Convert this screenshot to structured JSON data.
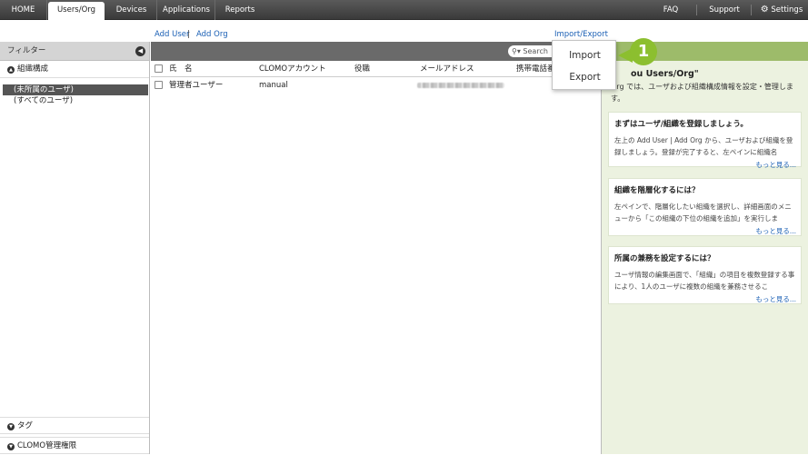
{
  "topnav": {
    "tabs": [
      {
        "label": "HOME"
      },
      {
        "label": "Users/Org"
      },
      {
        "label": "Devices"
      },
      {
        "label": "Applications"
      },
      {
        "label": "Reports"
      }
    ],
    "right": [
      {
        "label": "FAQ"
      },
      {
        "label": "Support"
      },
      {
        "label": "Settings"
      }
    ]
  },
  "actions": {
    "add_user": "Add User",
    "separator": "|",
    "add_org": "Add Org",
    "import_export": "Import/Export"
  },
  "sidebar": {
    "filter_header": "フィルター",
    "sections": {
      "org": "組織構成",
      "tag": "タグ",
      "admin": "CLOMO管理権限"
    },
    "tree": [
      {
        "label": "(未所属のユーザ)",
        "selected": true
      },
      {
        "label": "(すべてのユーザ)",
        "selected": false
      }
    ]
  },
  "search": {
    "placeholder": "Search"
  },
  "table": {
    "columns": [
      "氏　名",
      "CLOMOアカウント",
      "役職",
      "メールアドレス",
      "携帯電話番"
    ],
    "rows": [
      {
        "name": "管理者ユーザー",
        "account": "manual",
        "role": "",
        "email_redacted": true
      }
    ]
  },
  "menu": {
    "items": [
      {
        "label": "Import"
      },
      {
        "label": "Export"
      }
    ]
  },
  "callout": {
    "number": "1",
    "color": "#8cbf2f"
  },
  "info": {
    "title": "ou Users/Org\"",
    "desc": "Org では、ユーザおよび組織構成情報を設定・管理します。",
    "cards": [
      {
        "title": "まずはユーザ/組織を登録しましょう。",
        "body": "左上の Add User | Add Org から、ユーザおよび組織を登録しましょう。登録が完了すると、左ペインに組織名",
        "more": "もっと見る..."
      },
      {
        "title": "組織を階層化するには？",
        "body": "左ペインで、階層化したい組織を選択し、詳細画面のメニューから「この組織の下位の組織を追加」を実行しま",
        "more": "もっと見る..."
      },
      {
        "title": "所属の兼務を設定するには？",
        "body": "ユーザ情報の編集画面で、「組織」の項目を複数登録する事により、1人のユーザに複数の組織を兼務させるこ",
        "more": "もっと見る..."
      }
    ]
  },
  "colors": {
    "accent_green": "#8cbf2f",
    "info_header": "#9dbb6a",
    "info_bg": "#ecf2e0",
    "link_blue": "#1a5fb4"
  }
}
